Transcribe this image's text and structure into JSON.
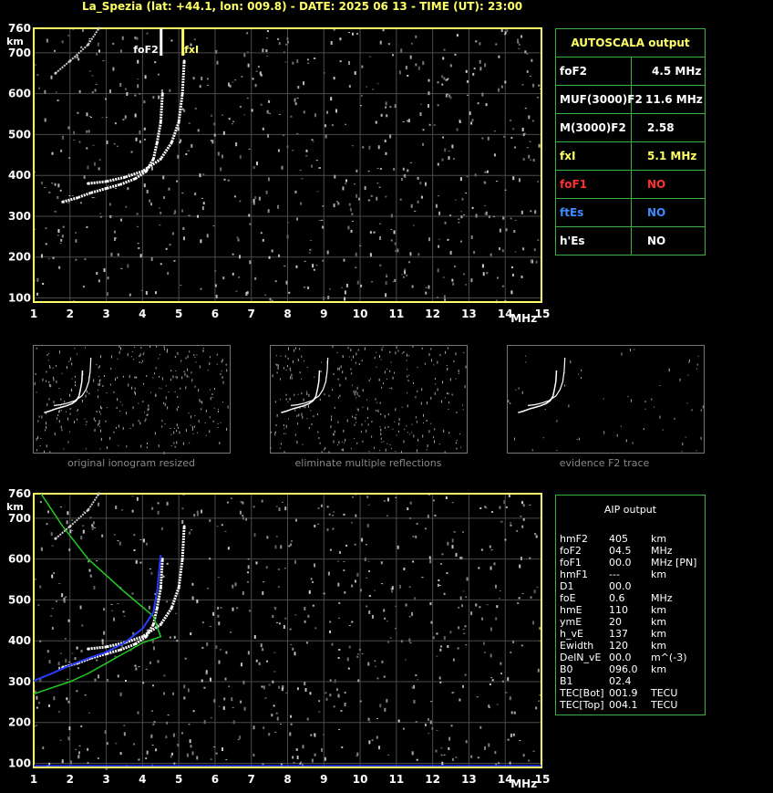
{
  "header": {
    "title": "La_Spezia (lat: +44.1, lon: 009.8) - DATE: 2025 06 13 - TIME (UT): 23:00"
  },
  "autoscala": {
    "title": "AUTOSCALA output",
    "rows": [
      {
        "label": "foF2",
        "value": "4.5 MHz",
        "label_color": "#ffffff",
        "value_color": "#ffffff"
      },
      {
        "label": "MUF(3000)F2",
        "value": "11.6 MHz",
        "label_color": "#ffffff",
        "value_color": "#ffffff"
      },
      {
        "label": "M(3000)F2",
        "value": "2.58",
        "label_color": "#ffffff",
        "value_color": "#ffffff"
      },
      {
        "label": "fxI",
        "value": "5.1 MHz",
        "label_color": "#ffff66",
        "value_color": "#ffff66"
      },
      {
        "label": "foF1",
        "value": "NO",
        "label_color": "#ff3030",
        "value_color": "#ff3030"
      },
      {
        "label": "ftEs",
        "value": "NO",
        "label_color": "#3b8cff",
        "value_color": "#3b8cff"
      },
      {
        "label": "h'Es",
        "value": "NO",
        "label_color": "#ffffff",
        "value_color": "#ffffff"
      }
    ]
  },
  "aip": {
    "title": "AIP output",
    "rows": [
      {
        "name": "hmF2",
        "val": "405",
        "unit": "km"
      },
      {
        "name": "foF2",
        "val": "04.5",
        "unit": "MHz"
      },
      {
        "name": "foF1",
        "val": "00.0",
        "unit": "MHz   [PN]"
      },
      {
        "name": "hmF1",
        "val": "---",
        "unit": "km"
      },
      {
        "name": "D1",
        "val": "00.0",
        "unit": ""
      },
      {
        "name": "foE",
        "val": "0.6",
        "unit": "MHz"
      },
      {
        "name": "hmE",
        "val": "110",
        "unit": "km"
      },
      {
        "name": "ymE",
        "val": "20",
        "unit": "km"
      },
      {
        "name": "h_vE",
        "val": "137",
        "unit": "km"
      },
      {
        "name": "Ewidth",
        "val": "120",
        "unit": "km"
      },
      {
        "name": "DelN_vE",
        "val": "00.0",
        "unit": "m^(-3)"
      },
      {
        "name": "B0",
        "val": "096.0",
        "unit": "km"
      },
      {
        "name": "B1",
        "val": "02.4",
        "unit": ""
      },
      {
        "name": "TEC[Bot]",
        "val": "001.9",
        "unit": "TECU"
      },
      {
        "name": "TEC[Top]",
        "val": "004.1",
        "unit": "TECU"
      }
    ]
  },
  "thumbnails": [
    {
      "caption": "original ionogram resized"
    },
    {
      "caption": "eliminate multiple reflections"
    },
    {
      "caption": "evidence F2 trace"
    }
  ],
  "colors": {
    "axis": "#ffff66",
    "grid": "#4a4a4a",
    "table_border": "#3cb043",
    "trace": "#ffffff",
    "profile": "#22cc22",
    "fit": "#2a3cff"
  },
  "chart_data": [
    {
      "type": "scatter",
      "name": "autoscala-ionogram",
      "x_ticks": [
        1,
        2,
        3,
        4,
        5,
        6,
        7,
        8,
        9,
        10,
        11,
        12,
        13,
        14,
        15
      ],
      "y_ticks": [
        100,
        200,
        300,
        400,
        500,
        600,
        700,
        760
      ],
      "xlabel": "MHz",
      "ylabel": "km",
      "xlim": [
        1,
        15
      ],
      "ylim": [
        90,
        760
      ],
      "markers": [
        {
          "label": "foF2",
          "x": 4.5,
          "color": "#ffffff"
        },
        {
          "label": "fxI",
          "x": 5.1,
          "color": "#ffff66"
        }
      ],
      "trace_o": [
        [
          1.8,
          335
        ],
        [
          2.2,
          345
        ],
        [
          2.6,
          358
        ],
        [
          3.0,
          368
        ],
        [
          3.4,
          378
        ],
        [
          3.8,
          392
        ],
        [
          4.1,
          410
        ],
        [
          4.3,
          440
        ],
        [
          4.4,
          480
        ],
        [
          4.5,
          530
        ],
        [
          4.55,
          600
        ]
      ],
      "trace_x": [
        [
          2.5,
          380
        ],
        [
          3.0,
          385
        ],
        [
          3.5,
          395
        ],
        [
          4.0,
          410
        ],
        [
          4.5,
          440
        ],
        [
          4.8,
          480
        ],
        [
          5.0,
          530
        ],
        [
          5.1,
          600
        ],
        [
          5.15,
          680
        ]
      ],
      "trace_multi": [
        [
          1.6,
          650
        ],
        [
          2.0,
          680
        ],
        [
          2.5,
          720
        ],
        [
          2.8,
          760
        ]
      ]
    },
    {
      "type": "scatter",
      "name": "aip-ionogram",
      "x_ticks": [
        1,
        2,
        3,
        4,
        5,
        6,
        7,
        8,
        9,
        10,
        11,
        12,
        13,
        14,
        15
      ],
      "y_ticks": [
        100,
        200,
        300,
        400,
        500,
        600,
        700,
        760
      ],
      "xlabel": "MHz",
      "ylabel": "km",
      "xlim": [
        1,
        15
      ],
      "ylim": [
        90,
        760
      ],
      "profile": [
        [
          1.0,
          270
        ],
        [
          1.5,
          285
        ],
        [
          2.0,
          300
        ],
        [
          2.5,
          320
        ],
        [
          3.0,
          345
        ],
        [
          3.5,
          370
        ],
        [
          4.0,
          395
        ],
        [
          4.5,
          410
        ],
        [
          4.3,
          460
        ],
        [
          3.5,
          520
        ],
        [
          2.5,
          600
        ],
        [
          1.8,
          680
        ],
        [
          1.2,
          760
        ]
      ],
      "fit": [
        [
          1.0,
          302
        ],
        [
          1.5,
          320
        ],
        [
          2.0,
          340
        ],
        [
          2.5,
          357
        ],
        [
          3.0,
          372
        ],
        [
          3.5,
          395
        ],
        [
          4.0,
          430
        ],
        [
          4.3,
          470
        ],
        [
          4.4,
          520
        ],
        [
          4.5,
          610
        ]
      ]
    }
  ]
}
